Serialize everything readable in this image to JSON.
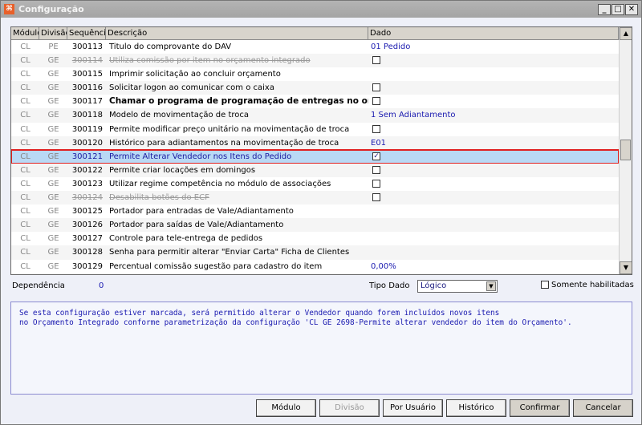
{
  "window": {
    "title": "Configuração",
    "minimize": "_",
    "maximize": "□",
    "close": "✕"
  },
  "grid": {
    "columns": [
      "Módulo",
      "Divisão",
      "Sequência",
      "Descrição",
      "Dado"
    ],
    "rows": [
      {
        "mod": "CL",
        "div": "PE",
        "seq": "300113",
        "desc": "Titulo do comprovante do DAV",
        "value": "01 Pedido",
        "type": "text",
        "state": ""
      },
      {
        "mod": "CL",
        "div": "GE",
        "seq": "300114",
        "desc": "Utiliza comissão por item no orçamento integrado",
        "value": "",
        "type": "check",
        "state": "dis"
      },
      {
        "mod": "CL",
        "div": "GE",
        "seq": "300115",
        "desc": "Imprimir solicitação ao concluir orçamento",
        "value": "",
        "type": "none",
        "state": ""
      },
      {
        "mod": "CL",
        "div": "GE",
        "seq": "300116",
        "desc": "Solicitar logon ao comunicar com o caixa",
        "value": "",
        "type": "check",
        "state": ""
      },
      {
        "mod": "CL",
        "div": "GE",
        "seq": "300117",
        "desc": "Chamar o programa de programação de entregas no orçamento i",
        "value": "",
        "type": "check",
        "state": "bold"
      },
      {
        "mod": "CL",
        "div": "GE",
        "seq": "300118",
        "desc": "Modelo de movimentação de troca",
        "value": "1 Sem Adiantamento",
        "type": "text",
        "state": ""
      },
      {
        "mod": "CL",
        "div": "GE",
        "seq": "300119",
        "desc": "Permite modificar preço unitário na movimentação de troca",
        "value": "",
        "type": "check",
        "state": ""
      },
      {
        "mod": "CL",
        "div": "GE",
        "seq": "300120",
        "desc": "Histórico para adiantamentos na movimentação de troca",
        "value": "E01",
        "type": "text",
        "state": ""
      },
      {
        "mod": "CL",
        "div": "GE",
        "seq": "300121",
        "desc": "Permite Alterar Vendedor nos Itens do Pedido",
        "value": "✓",
        "type": "checked",
        "state": "sel"
      },
      {
        "mod": "CL",
        "div": "GE",
        "seq": "300122",
        "desc": "Permite criar locações em domingos",
        "value": "",
        "type": "check",
        "state": ""
      },
      {
        "mod": "CL",
        "div": "GE",
        "seq": "300123",
        "desc": "Utilizar regime competência no módulo de associações",
        "value": "",
        "type": "check",
        "state": ""
      },
      {
        "mod": "CL",
        "div": "GE",
        "seq": "300124",
        "desc": "Desabilita botões do ECF",
        "value": "",
        "type": "check",
        "state": "dis"
      },
      {
        "mod": "CL",
        "div": "GE",
        "seq": "300125",
        "desc": "Portador para entradas de Vale/Adiantamento",
        "value": "",
        "type": "none",
        "state": ""
      },
      {
        "mod": "CL",
        "div": "GE",
        "seq": "300126",
        "desc": "Portador para saídas de Vale/Adiantamento",
        "value": "",
        "type": "none",
        "state": ""
      },
      {
        "mod": "CL",
        "div": "GE",
        "seq": "300127",
        "desc": "Controle para tele-entrega de pedidos",
        "value": "",
        "type": "none",
        "state": ""
      },
      {
        "mod": "CL",
        "div": "GE",
        "seq": "300128",
        "desc": "Senha para permitir alterar \"Enviar Carta\" Ficha de Clientes",
        "value": "",
        "type": "none",
        "state": ""
      },
      {
        "mod": "CL",
        "div": "GE",
        "seq": "300129",
        "desc": "Percentual comissão sugestão para cadastro do item",
        "value": "0,00%",
        "type": "text",
        "state": ""
      }
    ]
  },
  "details": {
    "dependencia_label": "Dependência",
    "dependencia_value": "0",
    "tipo_dado_label": "Tipo Dado",
    "tipo_dado_value": "Lógico",
    "somente_label": "Somente habilitadas"
  },
  "description": {
    "line1": "Se esta configuração estiver marcada, será permitido alterar o Vendedor quando forem incluídos novos itens",
    "line2": "no Orçamento Integrado conforme parametrização da configuração 'CL GE 2698-Permite alterar vendedor do item do Orçamento'."
  },
  "buttons": {
    "modulo": "Módulo",
    "divisao": "Divisão",
    "por_usuario": "Por Usuário",
    "historico": "Histórico",
    "confirmar": "Confirmar",
    "cancelar": "Cancelar"
  }
}
